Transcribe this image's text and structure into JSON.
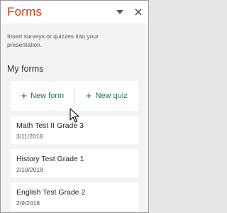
{
  "header": {
    "title": "Forms",
    "menu_icon": "chevron-down-icon",
    "close_icon": "close-icon"
  },
  "intro": {
    "text": "Insert surveys or quizzes into your presentation."
  },
  "section": {
    "title": "My forms"
  },
  "actions": {
    "new_form_label": "New form",
    "new_quiz_label": "New quiz",
    "plus_icon": "plus-icon"
  },
  "forms": [
    {
      "name": "Math Test II Grade 3",
      "date": "3/11/2018"
    },
    {
      "name": "History Test Grade 1",
      "date": "2/10/2018"
    },
    {
      "name": "English Test Grade 2",
      "date": "2/9/2018"
    }
  ],
  "colors": {
    "brand_title": "#c43e1c",
    "action_green": "#217346",
    "panel_background": "#f3f3f3"
  }
}
